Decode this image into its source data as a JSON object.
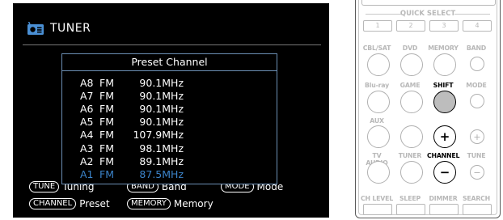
{
  "tuner": {
    "title": "TUNER",
    "popup_title": "Preset Channel",
    "presets": [
      {
        "num": "A8",
        "band": "FM",
        "freq": "90.1MHz",
        "selected": false
      },
      {
        "num": "A7",
        "band": "FM",
        "freq": "90.1MHz",
        "selected": false
      },
      {
        "num": "A6",
        "band": "FM",
        "freq": "90.1MHz",
        "selected": false
      },
      {
        "num": "A5",
        "band": "FM",
        "freq": "90.1MHz",
        "selected": false
      },
      {
        "num": "A4",
        "band": "FM",
        "freq": "107.9MHz",
        "selected": false
      },
      {
        "num": "A3",
        "band": "FM",
        "freq": "98.1MHz",
        "selected": false
      },
      {
        "num": "A2",
        "band": "FM",
        "freq": "89.1MHz",
        "selected": false
      },
      {
        "num": "A1",
        "band": "FM",
        "freq": "87.5MHz",
        "selected": true
      }
    ],
    "legend": {
      "tune_key": "TUNE",
      "tune_label": "Tuning",
      "band_key": "BAND",
      "band_label": "Band",
      "mode_key": "MODE",
      "mode_label": "Mode",
      "channel_key": "CHANNEL",
      "channel_label": "Preset",
      "memory_key": "MEMORY",
      "memory_label": "Memory"
    },
    "selected_color": "#3b83c9",
    "border_color": "#6c8fb5"
  },
  "remote": {
    "quick_select_label": "QUICK SELECT",
    "quick_select_buttons": [
      "1",
      "2",
      "3",
      "4"
    ],
    "row1_labels": [
      "CBL/SAT",
      "DVD",
      "MEMORY",
      "BAND"
    ],
    "row2_labels": [
      "Blu-ray",
      "GAME",
      "SHIFT",
      "MODE"
    ],
    "row3_labels": [
      "AUX"
    ],
    "row4_labels": [
      "TV AUDIO",
      "TUNER",
      "CHANNEL",
      "TUNE"
    ],
    "row5_labels": [
      "CH LEVEL",
      "SLEEP",
      "DIMMER",
      "SEARCH"
    ],
    "plus_glyph": "+",
    "minus_glyph": "−"
  }
}
